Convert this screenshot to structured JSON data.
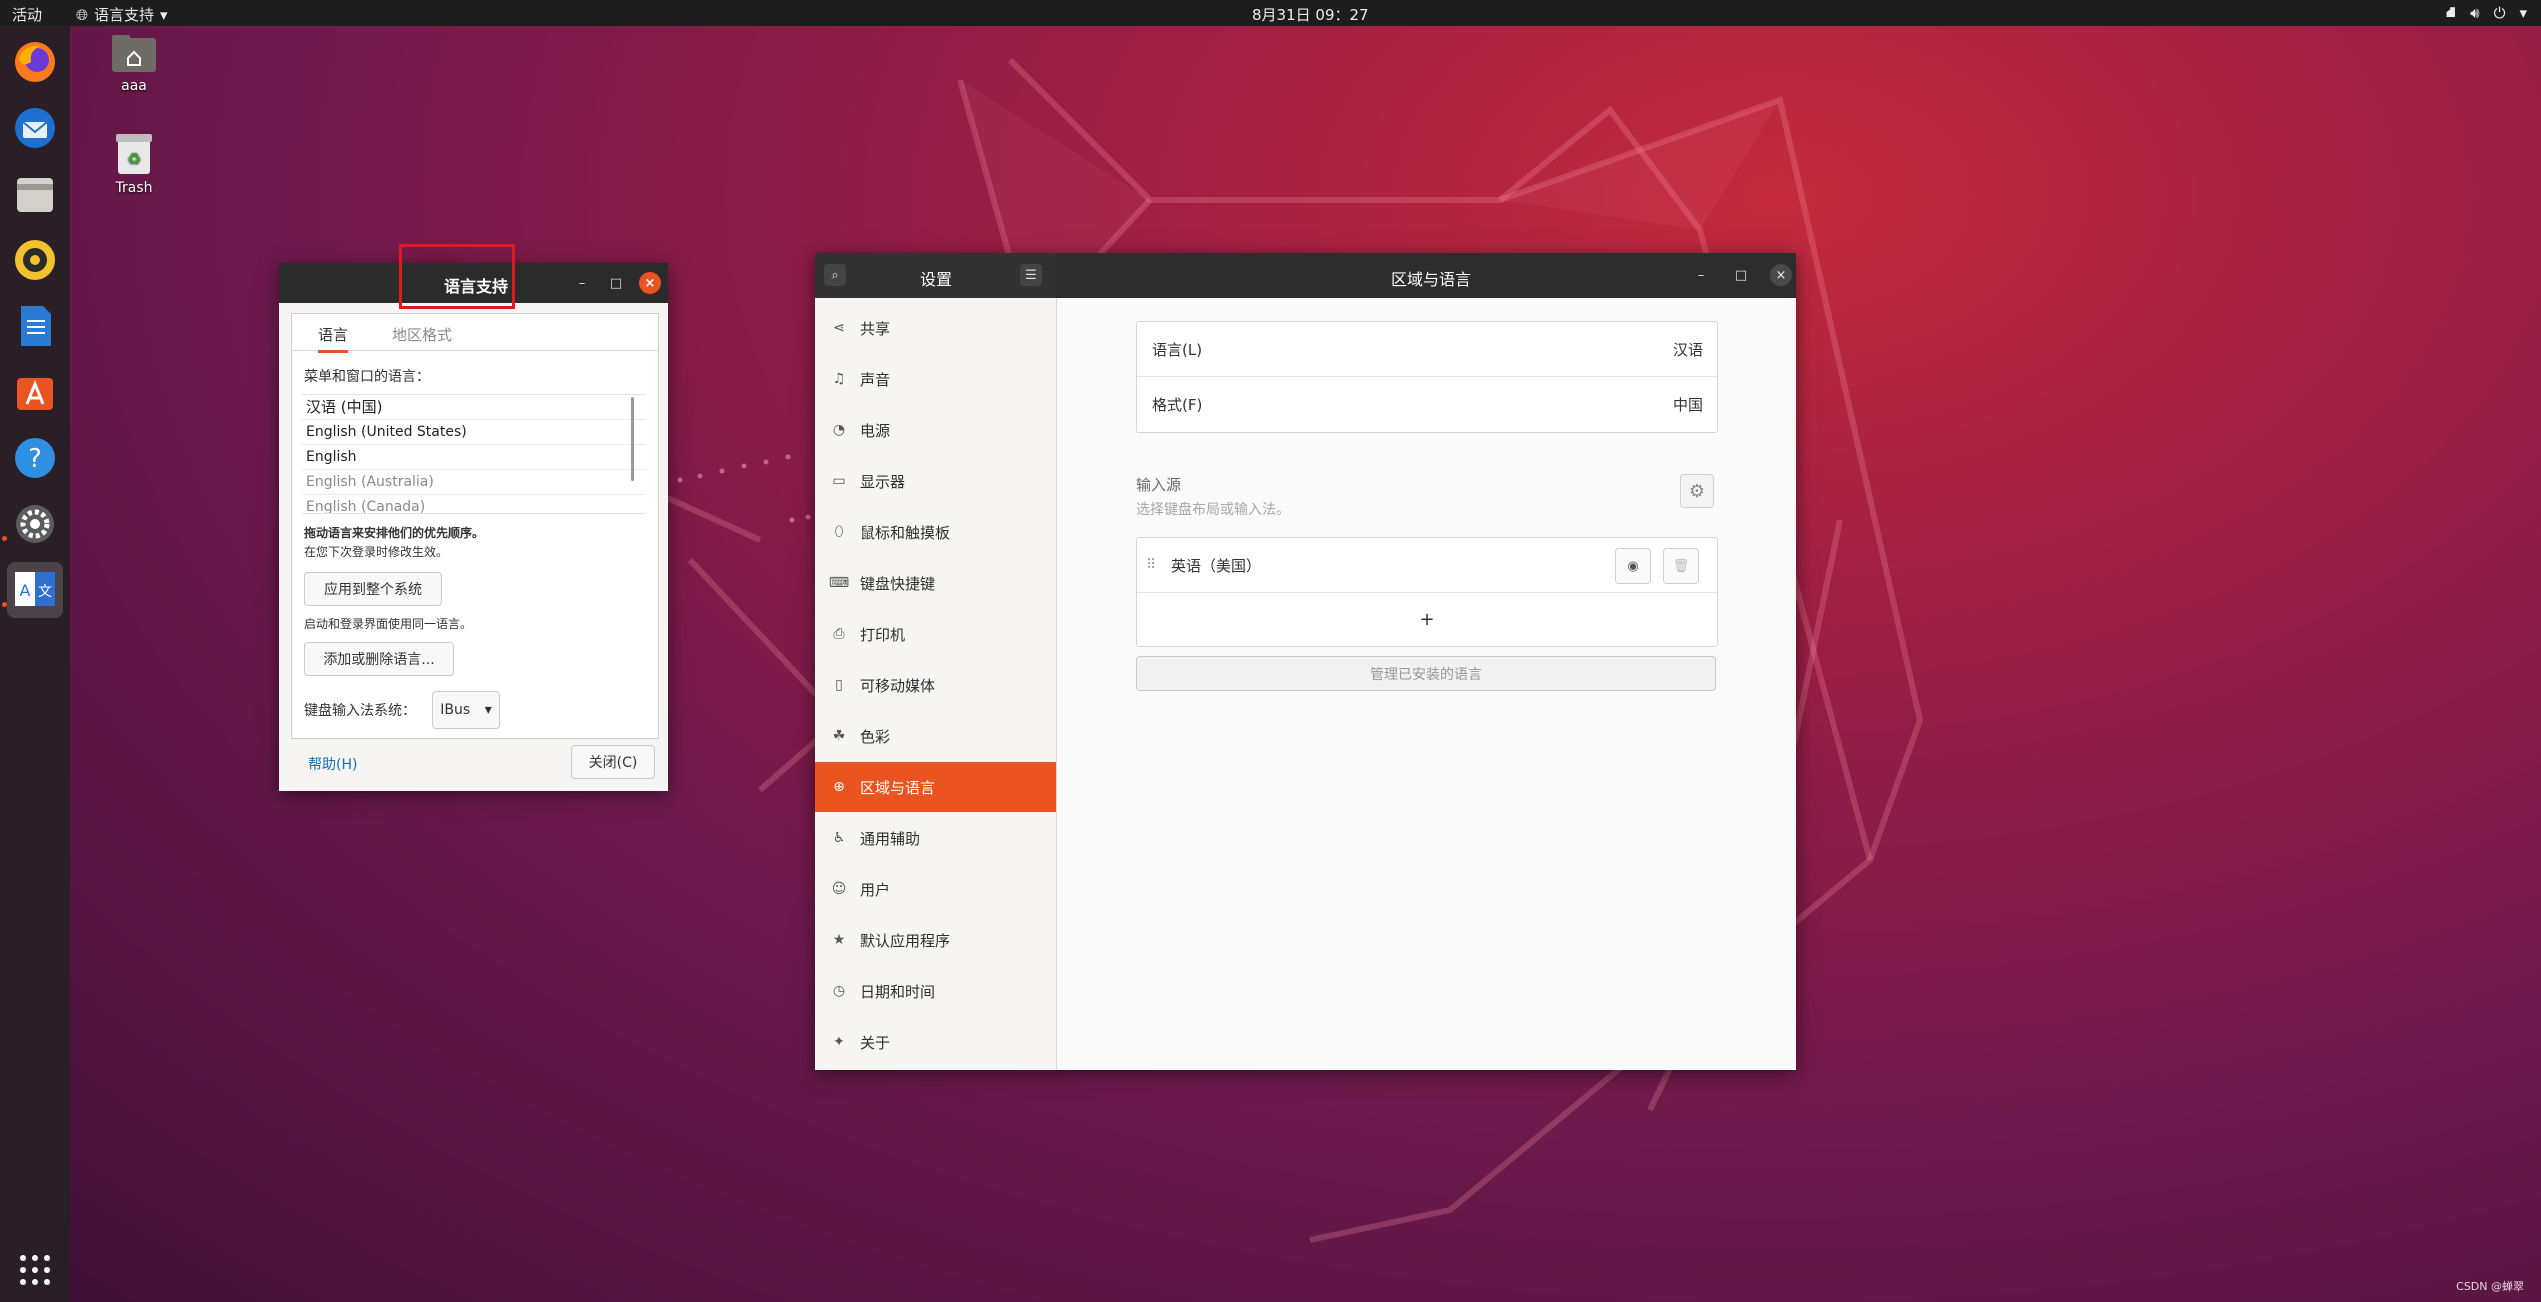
{
  "topbar": {
    "activities": "活动",
    "app_menu": "语言支持",
    "clock": "8月31日  09：27"
  },
  "desktop": {
    "icons": [
      {
        "label": "aaa"
      },
      {
        "label": "Trash"
      }
    ],
    "watermark": "CSDN @蝉翠"
  },
  "dock": {
    "items": [
      "Firefox",
      "Thunderbird",
      "Files",
      "Rhythmbox",
      "LibreOffice Writer",
      "Ubuntu Software",
      "Help",
      "Settings",
      "Language Support"
    ],
    "show_apps": "Show Applications"
  },
  "lang_window": {
    "title": "语言支持",
    "tabs": [
      "语言",
      "地区格式"
    ],
    "list_caption": "菜单和窗口的语言：",
    "languages": [
      "汉语 (中国)",
      "English (United States)",
      "English",
      "English (Australia)",
      "English (Canada)"
    ],
    "drag_hint": "拖动语言来安排他们的优先顺序。",
    "drag_hint2": "在您下次登录时修改生效。",
    "apply_button": "应用到整个系统",
    "login_hint": "启动和登录界面使用同一语言。",
    "add_remove_button": "添加或删除语言...",
    "ime_label": "键盘输入法系统：",
    "ime_value": "IBus",
    "help_link": "帮助(H)",
    "close_button": "关闭(C)"
  },
  "settings": {
    "sidebar_title": "设置",
    "page_title": "区域与语言",
    "sidebar": [
      {
        "label": "共享",
        "icon": "share-icon"
      },
      {
        "label": "声音",
        "icon": "music-note-icon"
      },
      {
        "label": "电源",
        "icon": "power-icon"
      },
      {
        "label": "显示器",
        "icon": "display-icon"
      },
      {
        "label": "鼠标和触摸板",
        "icon": "mouse-icon"
      },
      {
        "label": "键盘快捷键",
        "icon": "keyboard-icon"
      },
      {
        "label": "打印机",
        "icon": "printer-icon"
      },
      {
        "label": "可移动媒体",
        "icon": "media-icon"
      },
      {
        "label": "色彩",
        "icon": "color-icon"
      },
      {
        "label": "区域与语言",
        "icon": "globe-icon",
        "active": true
      },
      {
        "label": "通用辅助",
        "icon": "accessibility-icon"
      },
      {
        "label": "用户",
        "icon": "user-icon"
      },
      {
        "label": "默认应用程序",
        "icon": "star-icon"
      },
      {
        "label": "日期和时间",
        "icon": "clock-icon"
      },
      {
        "label": "关于",
        "icon": "sparkle-icon"
      }
    ],
    "language_label": "语言(L)",
    "language_value": "汉语",
    "format_label": "格式(F)",
    "format_value": "中国",
    "input_sources_title": "输入源",
    "input_sources_hint": "选择键盘布局或输入法。",
    "input_source": "英语（美国）",
    "add_symbol": "+",
    "manage_button": "管理已安装的语言"
  },
  "colors": {
    "accent": "#e95420",
    "titlebar": "#2b2b2b"
  }
}
